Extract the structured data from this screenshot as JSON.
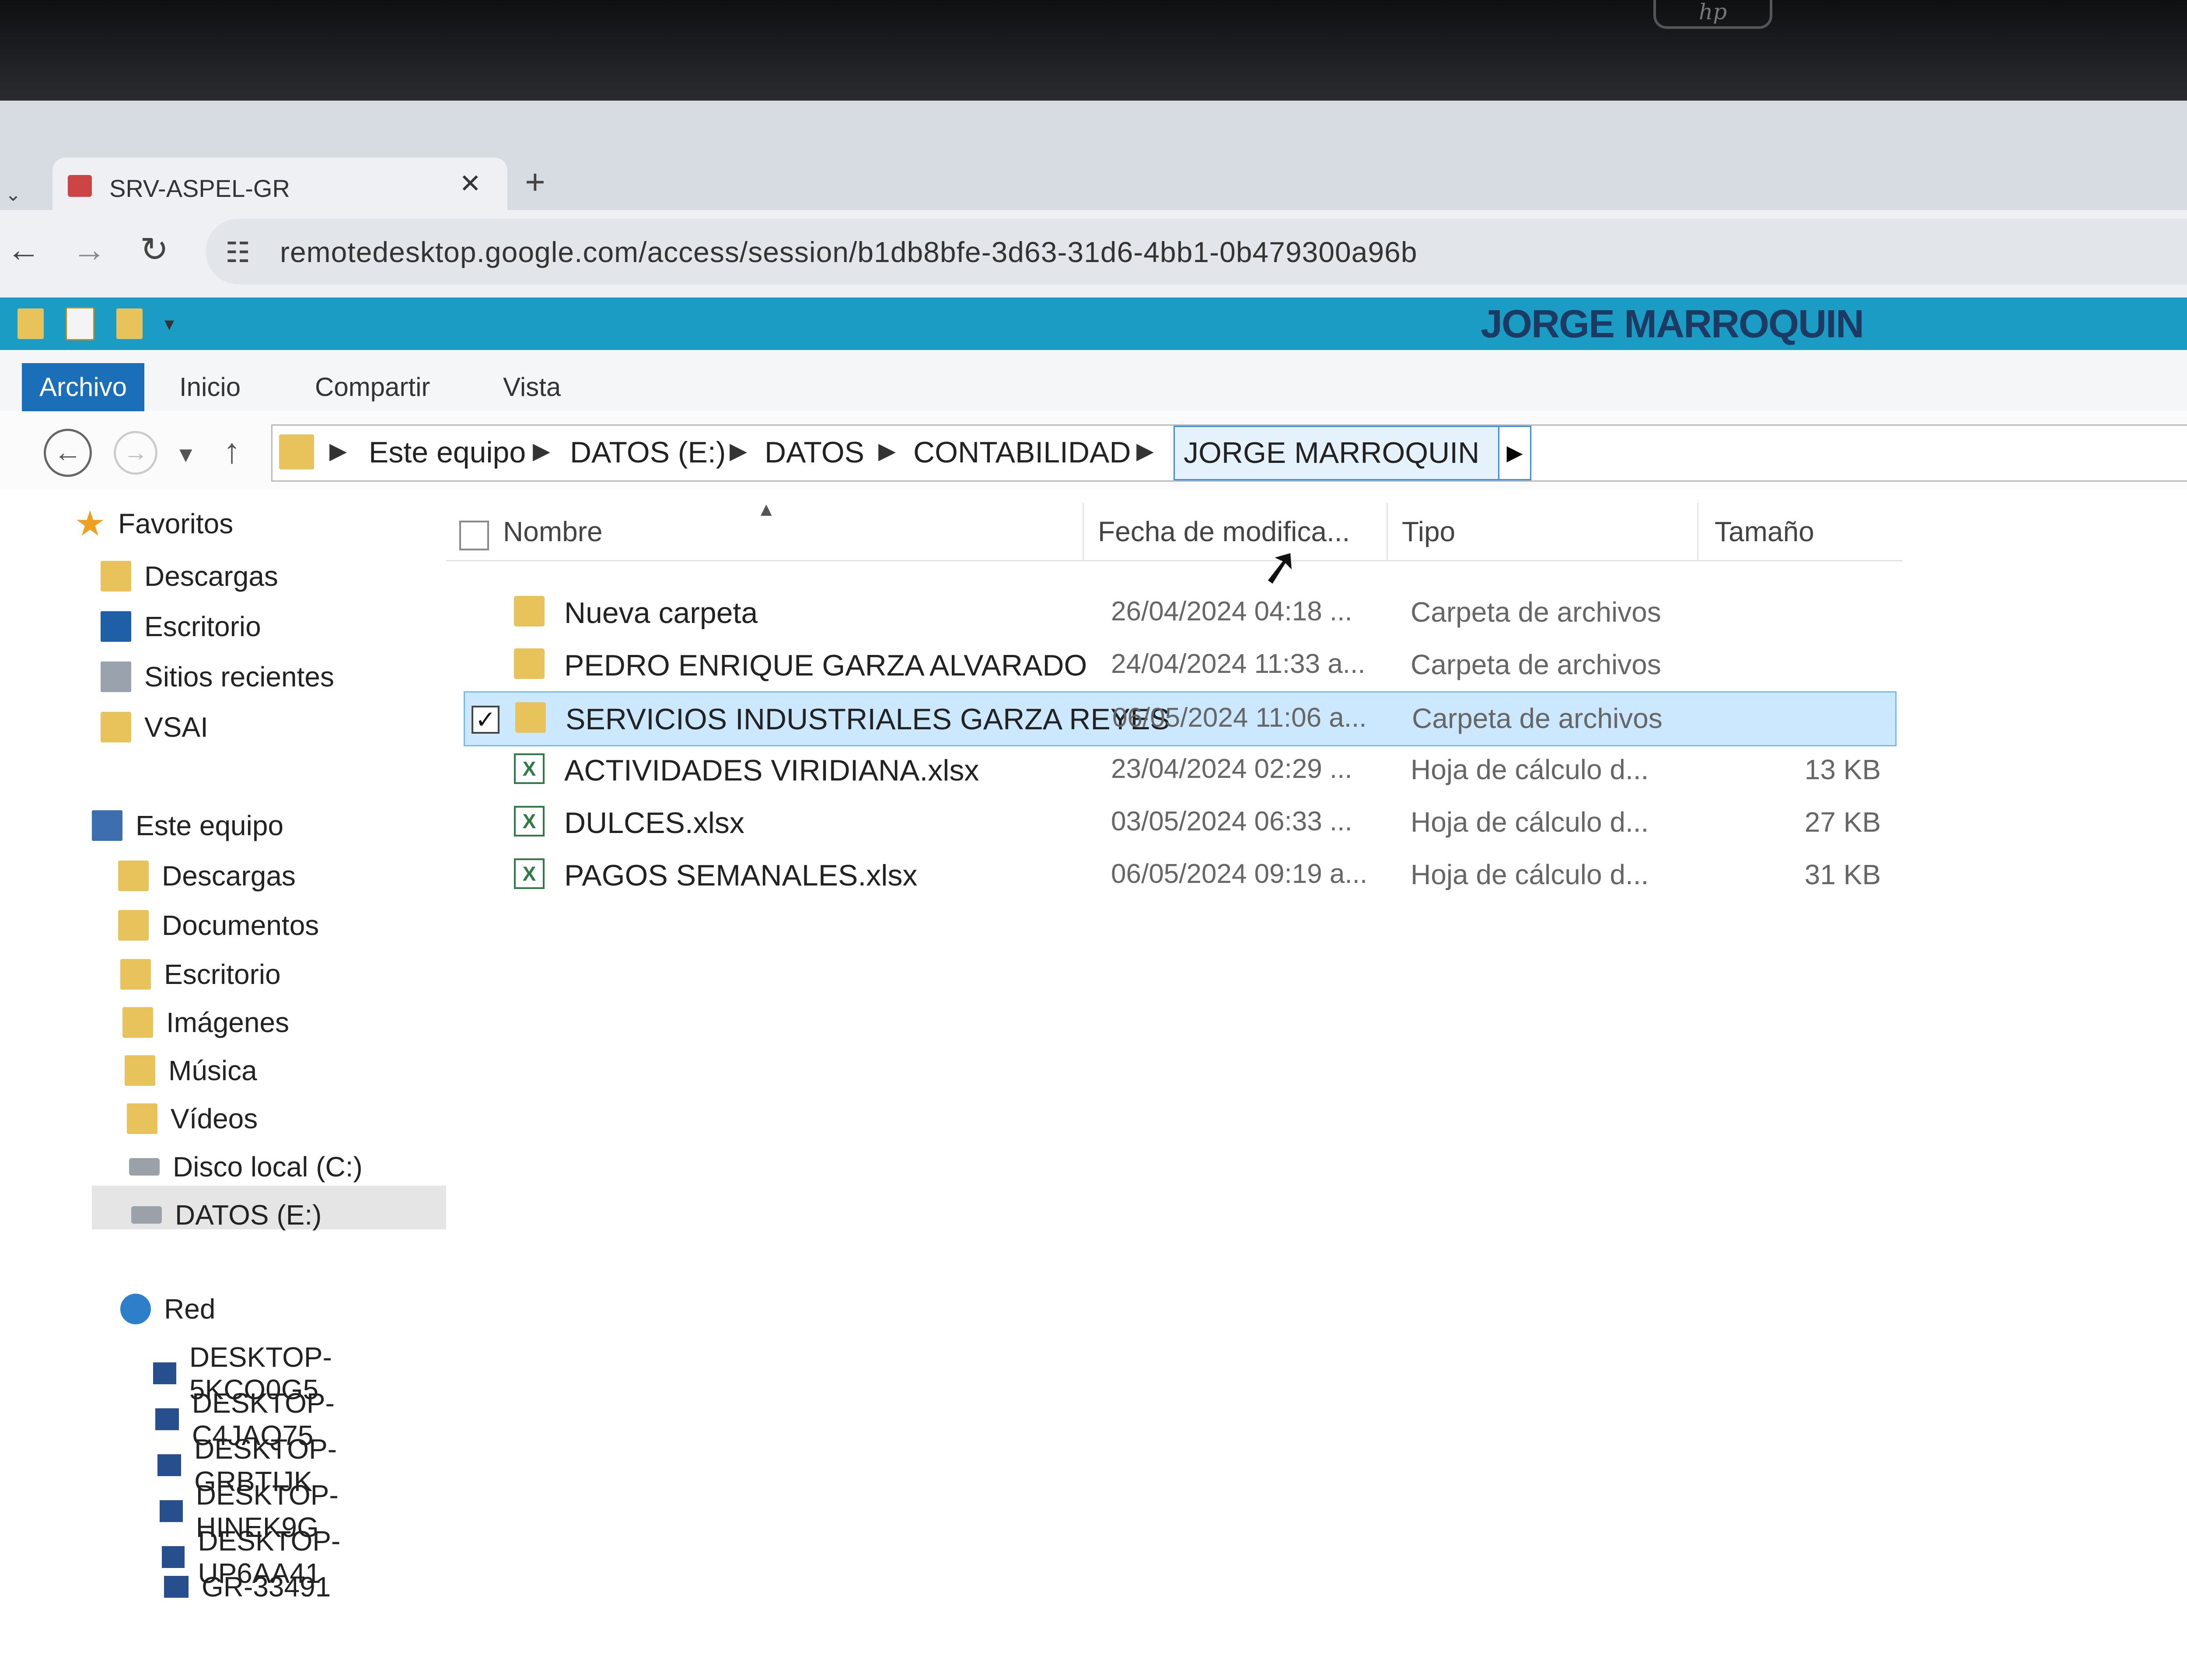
{
  "browser": {
    "tab_title": "SRV-ASPEL-GR",
    "tab_close": "✕",
    "new_tab": "+",
    "url": "remotedesktop.google.com/access/session/b1db8bfe-3d63-31d6-4bb1-0b479300a96b"
  },
  "explorer": {
    "window_title": "JORGE MARROQUIN",
    "ribbon_tabs": [
      "Archivo",
      "Inicio",
      "Compartir",
      "Vista"
    ],
    "breadcrumb": [
      "Este equipo",
      "DATOS (E:)",
      "DATOS",
      "CONTABILIDAD"
    ],
    "breadcrumb_current": "JORGE MARROQUIN",
    "columns": {
      "name": "Nombre",
      "date": "Fecha de modifica...",
      "type": "Tipo",
      "size": "Tamaño"
    },
    "files": [
      {
        "name": "Nueva carpeta",
        "date": "26/04/2024 04:18 ...",
        "type": "Carpeta de archivos",
        "size": "",
        "kind": "folder",
        "selected": false
      },
      {
        "name": "PEDRO ENRIQUE GARZA ALVARADO",
        "date": "24/04/2024 11:33 a...",
        "type": "Carpeta de archivos",
        "size": "",
        "kind": "folder",
        "selected": false
      },
      {
        "name": "SERVICIOS INDUSTRIALES GARZA REYES",
        "date": "06/05/2024 11:06 a...",
        "type": "Carpeta de archivos",
        "size": "",
        "kind": "folder",
        "selected": true
      },
      {
        "name": "ACTIVIDADES VIRIDIANA.xlsx",
        "date": "23/04/2024 02:29 ...",
        "type": "Hoja de cálculo d...",
        "size": "13 KB",
        "kind": "xlsx",
        "selected": false
      },
      {
        "name": "DULCES.xlsx",
        "date": "03/05/2024 06:33 ...",
        "type": "Hoja de cálculo d...",
        "size": "27 KB",
        "kind": "xlsx",
        "selected": false
      },
      {
        "name": "PAGOS SEMANALES.xlsx",
        "date": "06/05/2024 09:19 a...",
        "type": "Hoja de cálculo d...",
        "size": "31 KB",
        "kind": "xlsx",
        "selected": false
      }
    ],
    "nav": {
      "favorites_label": "Favoritos",
      "favorites": [
        "Descargas",
        "Escritorio",
        "Sitios recientes",
        "VSAI"
      ],
      "pc_label": "Este equipo",
      "pc_items": [
        "Descargas",
        "Documentos",
        "Escritorio",
        "Imágenes",
        "Música",
        "Vídeos",
        "Disco local (C:)",
        "DATOS (E:)"
      ],
      "network_label": "Red",
      "network_items": [
        "DESKTOP-5KCO0G5",
        "DESKTOP-C4JAQ75",
        "DESKTOP-GRBTIJK",
        "DESKTOP-HINEK9G",
        "DESKTOP-UP6AA41",
        "GR-33491"
      ]
    }
  },
  "colors": {
    "titlebar": "#1a9cc4",
    "selection": "#cce8ff",
    "archivo_tab": "#1a6fb8"
  }
}
